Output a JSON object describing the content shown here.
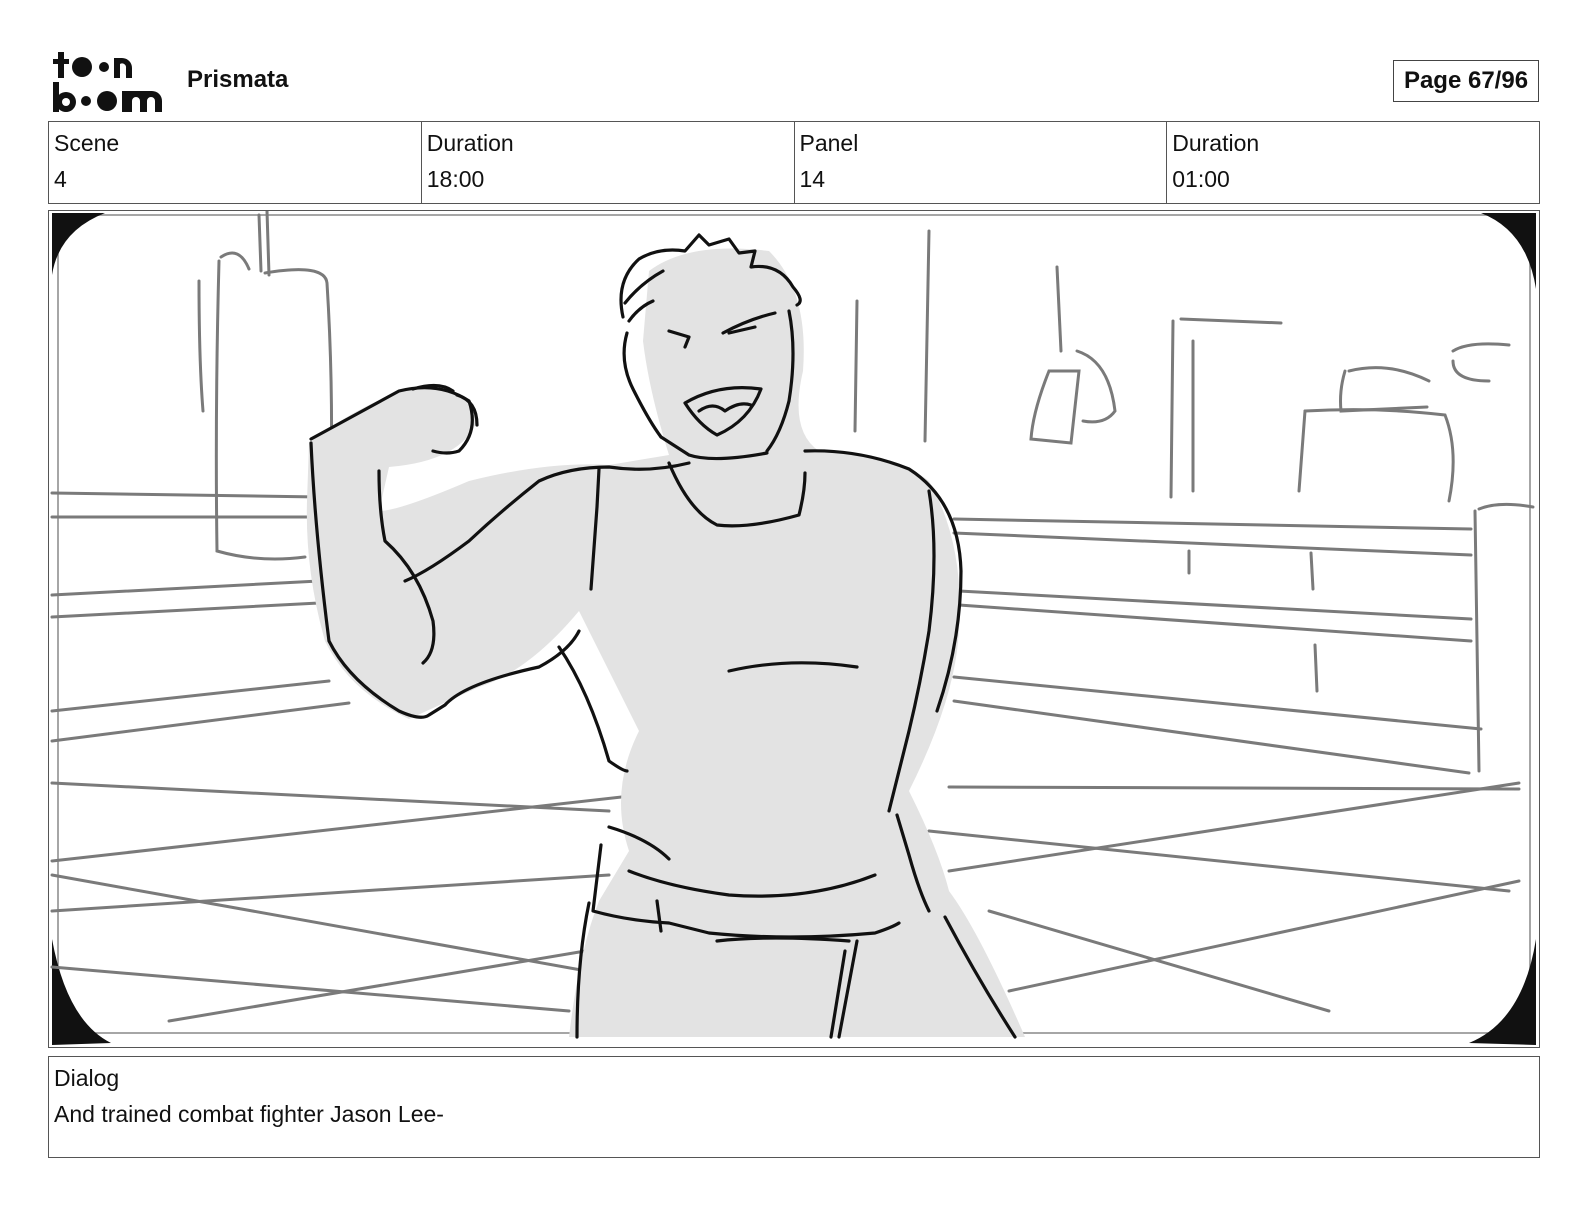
{
  "header": {
    "logo_line1": "toon",
    "logo_line2": "boom",
    "project_title": "Prismata",
    "page_label": "Page 67/96"
  },
  "info": [
    {
      "label": "Scene",
      "value": "4"
    },
    {
      "label": "Duration",
      "value": "18:00"
    },
    {
      "label": "Panel",
      "value": "14"
    },
    {
      "label": "Duration",
      "value": "01:00"
    }
  ],
  "dialog": {
    "label": "Dialog",
    "text": "And trained combat fighter Jason Lee-"
  },
  "colors": {
    "ink": "#111111",
    "sketch_gray": "#7a7a7a",
    "fill_gray": "#e3e3e3"
  }
}
